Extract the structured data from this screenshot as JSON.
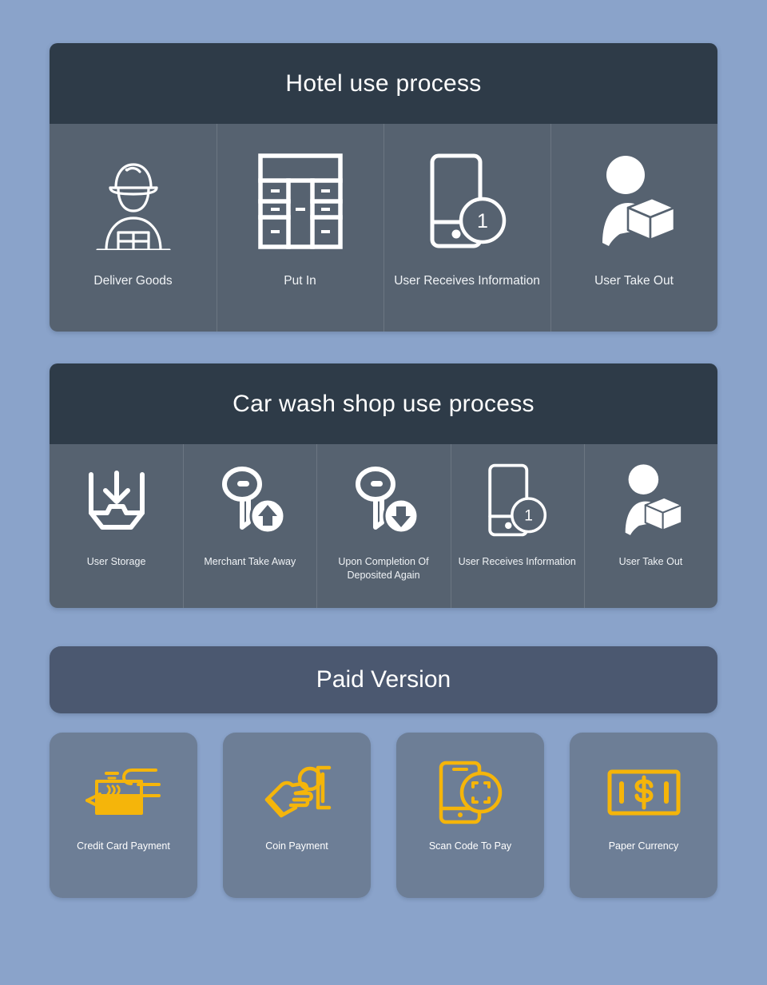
{
  "theme": {
    "page_background": "#8aa3ca",
    "panel_header_background": "#2e3b48",
    "panel_body_background": "#566270",
    "paid_header_background": "#4b5870",
    "pay_card_background": "#6d7e96",
    "icon_stroke_white": "#ffffff",
    "icon_stroke_gold": "#f5b50a",
    "label_color": "#f0f3f6"
  },
  "sections": [
    {
      "id": "hotel",
      "title": "Hotel use process",
      "steps": [
        {
          "label": "Deliver Goods",
          "icon": "delivery-person-icon"
        },
        {
          "label": "Put In",
          "icon": "locker-cabinet-icon"
        },
        {
          "label": "User Receives Information",
          "icon": "phone-notification-icon",
          "badge": "1"
        },
        {
          "label": "User Take Out",
          "icon": "person-carrying-box-icon"
        }
      ]
    },
    {
      "id": "carwash",
      "title": "Car wash shop use process",
      "steps": [
        {
          "label": "User Storage",
          "icon": "storage-down-arrow-icon"
        },
        {
          "label": "Merchant Take Away",
          "icon": "key-up-arrow-icon"
        },
        {
          "label": "Upon Completion Of Deposited Again",
          "icon": "key-down-arrow-icon"
        },
        {
          "label": "User Receives Information",
          "icon": "phone-notification-icon",
          "badge": "1"
        },
        {
          "label": "User Take Out",
          "icon": "person-carrying-box-icon"
        }
      ]
    }
  ],
  "paid": {
    "title": "Paid Version",
    "methods": [
      {
        "label": "Credit Card Payment",
        "icon": "credit-card-hand-icon"
      },
      {
        "label": "Coin Payment",
        "icon": "coin-insert-hand-icon"
      },
      {
        "label": "Scan Code To Pay",
        "icon": "phone-qr-scan-icon"
      },
      {
        "label": "Paper Currency",
        "icon": "banknote-dollar-icon"
      }
    ]
  }
}
